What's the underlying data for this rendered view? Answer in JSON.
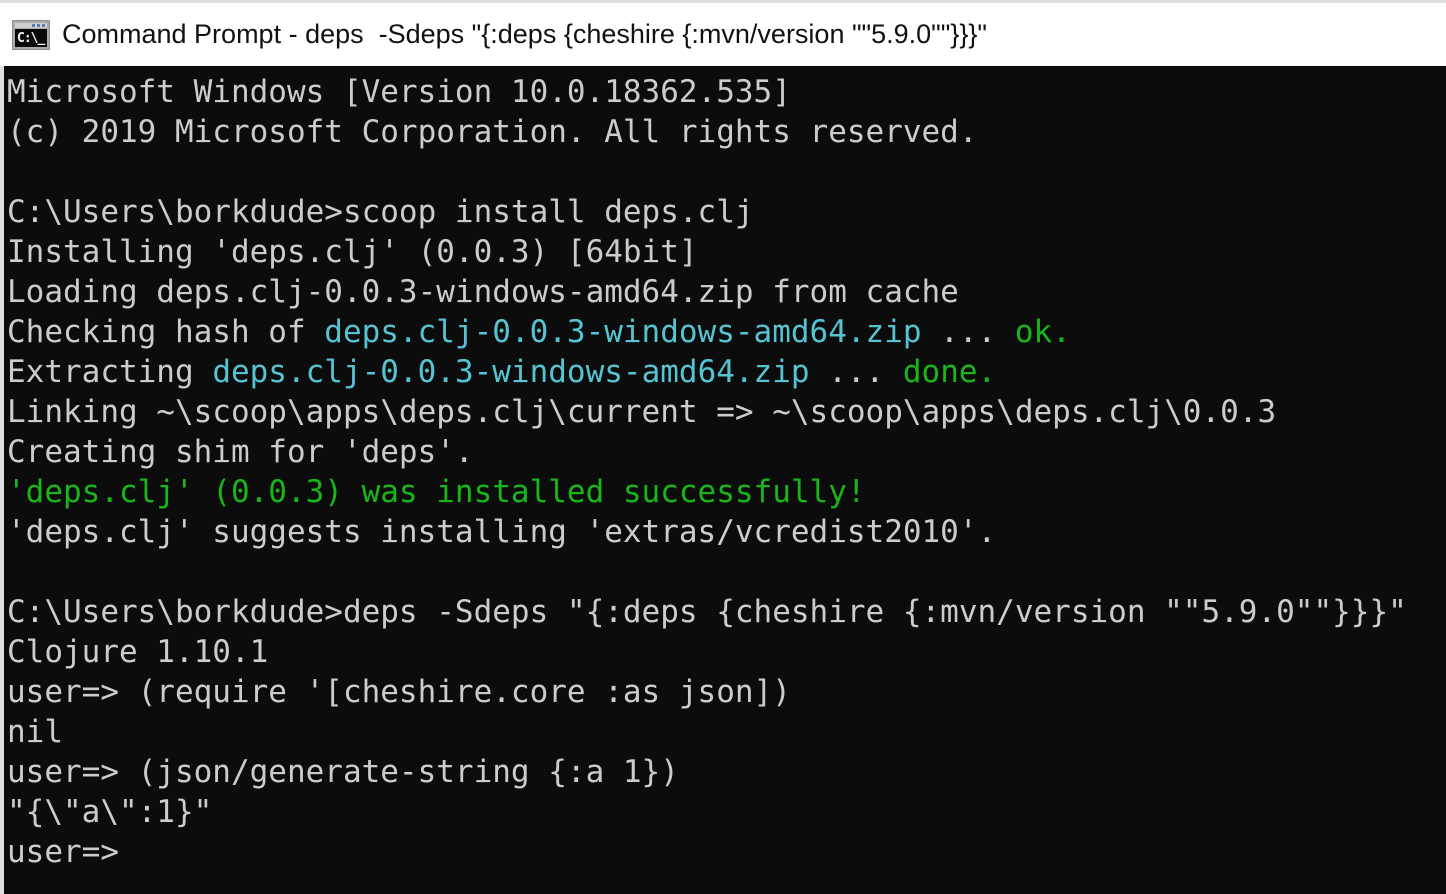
{
  "window": {
    "title": "Command Prompt - deps  -Sdeps \"{:deps {cheshire {:mvn/version \"\"5.9.0\"\"}}}\"",
    "icon": "cmd-icon",
    "icon_text": "C:\\_"
  },
  "colors": {
    "background": "#0C0C0C",
    "foreground": "#CCCCCC",
    "cyan": "#55C3D2",
    "green": "#19B619",
    "titlebar_bg": "#FFFFFF",
    "titlebar_fg": "#111111",
    "border": "#E0E0E0"
  },
  "terminal": {
    "lines": [
      {
        "segments": [
          {
            "text": "Microsoft Windows [Version 10.0.18362.535]",
            "color": "fg"
          }
        ]
      },
      {
        "segments": [
          {
            "text": "(c) 2019 Microsoft Corporation. All rights reserved.",
            "color": "fg"
          }
        ]
      },
      {
        "segments": []
      },
      {
        "segments": [
          {
            "text": "C:\\Users\\borkdude>scoop install deps.clj",
            "color": "fg"
          }
        ]
      },
      {
        "segments": [
          {
            "text": "Installing 'deps.clj' (0.0.3) [64bit]",
            "color": "fg"
          }
        ]
      },
      {
        "segments": [
          {
            "text": "Loading deps.clj-0.0.3-windows-amd64.zip from cache",
            "color": "fg"
          }
        ]
      },
      {
        "segments": [
          {
            "text": "Checking hash of ",
            "color": "fg"
          },
          {
            "text": "deps.clj-0.0.3-windows-amd64.zip",
            "color": "cyan"
          },
          {
            "text": " ... ",
            "color": "fg"
          },
          {
            "text": "ok.",
            "color": "green"
          }
        ]
      },
      {
        "segments": [
          {
            "text": "Extracting ",
            "color": "fg"
          },
          {
            "text": "deps.clj-0.0.3-windows-amd64.zip",
            "color": "cyan"
          },
          {
            "text": " ... ",
            "color": "fg"
          },
          {
            "text": "done.",
            "color": "green"
          }
        ]
      },
      {
        "segments": [
          {
            "text": "Linking ~\\scoop\\apps\\deps.clj\\current => ~\\scoop\\apps\\deps.clj\\0.0.3",
            "color": "fg"
          }
        ]
      },
      {
        "segments": [
          {
            "text": "Creating shim for 'deps'.",
            "color": "fg"
          }
        ]
      },
      {
        "segments": [
          {
            "text": "'deps.clj' (0.0.3) was installed successfully!",
            "color": "green"
          }
        ]
      },
      {
        "segments": [
          {
            "text": "'deps.clj' suggests installing 'extras/vcredist2010'.",
            "color": "fg"
          }
        ]
      },
      {
        "segments": []
      },
      {
        "segments": [
          {
            "text": "C:\\Users\\borkdude>deps -Sdeps \"{:deps {cheshire {:mvn/version \"\"5.9.0\"\"}}}\"",
            "color": "fg"
          }
        ]
      },
      {
        "segments": [
          {
            "text": "Clojure 1.10.1",
            "color": "fg"
          }
        ]
      },
      {
        "segments": [
          {
            "text": "user=> (require '[cheshire.core :as json])",
            "color": "fg"
          }
        ]
      },
      {
        "segments": [
          {
            "text": "nil",
            "color": "fg"
          }
        ]
      },
      {
        "segments": [
          {
            "text": "user=> (json/generate-string {:a 1})",
            "color": "fg"
          }
        ]
      },
      {
        "segments": [
          {
            "text": "\"{\\\"a\\\":1}\"",
            "color": "fg"
          }
        ]
      },
      {
        "segments": [
          {
            "text": "user=>",
            "color": "fg"
          }
        ]
      }
    ]
  }
}
